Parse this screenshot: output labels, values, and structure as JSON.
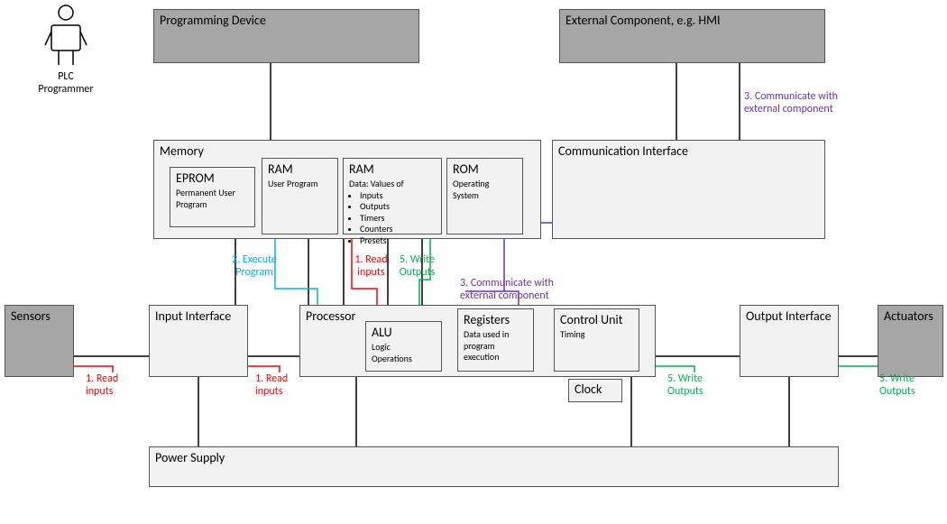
{
  "programmer": {
    "title": "PLC",
    "title2": "Programmer"
  },
  "progdev": {
    "title": "Programming Device"
  },
  "extcomp": {
    "title": "External Component, e.g. HMI"
  },
  "memory": {
    "title": "Memory",
    "eprom": {
      "title": "EPROM",
      "sub": "Permanent User Program"
    },
    "ram1": {
      "title": "RAM",
      "sub": "User Program"
    },
    "ram2": {
      "title": "RAM",
      "sub": "Data: Values of",
      "b1": "Inputs",
      "b2": "Outputs",
      "b3": "Timers",
      "b4": "Counters",
      "b5": "Presets"
    },
    "rom": {
      "title": "ROM",
      "sub": "Operating System"
    }
  },
  "comm": {
    "title": "Communication Interface"
  },
  "sensors": {
    "title": "Sensors"
  },
  "input": {
    "title": "Input Interface"
  },
  "processor": {
    "title": "Processor",
    "alu": {
      "title": "ALU",
      "sub1": "Logic",
      "sub2": "Operations"
    },
    "reg": {
      "title": "Registers",
      "sub1": "Data used in",
      "sub2": "program",
      "sub3": "execution"
    },
    "ctrl": {
      "title": "Control Unit",
      "sub": "Timing"
    },
    "clock": {
      "title": "Clock"
    }
  },
  "output": {
    "title": "Output Interface"
  },
  "actuators": {
    "title": "Actuators"
  },
  "power": {
    "title": "Power Supply"
  },
  "labels": {
    "readInputs": "1. Read inputs",
    "execute": "2. Execute Program",
    "communicate": "3. Communicate with external component",
    "writeOutputs": "5. Write Outputs"
  }
}
